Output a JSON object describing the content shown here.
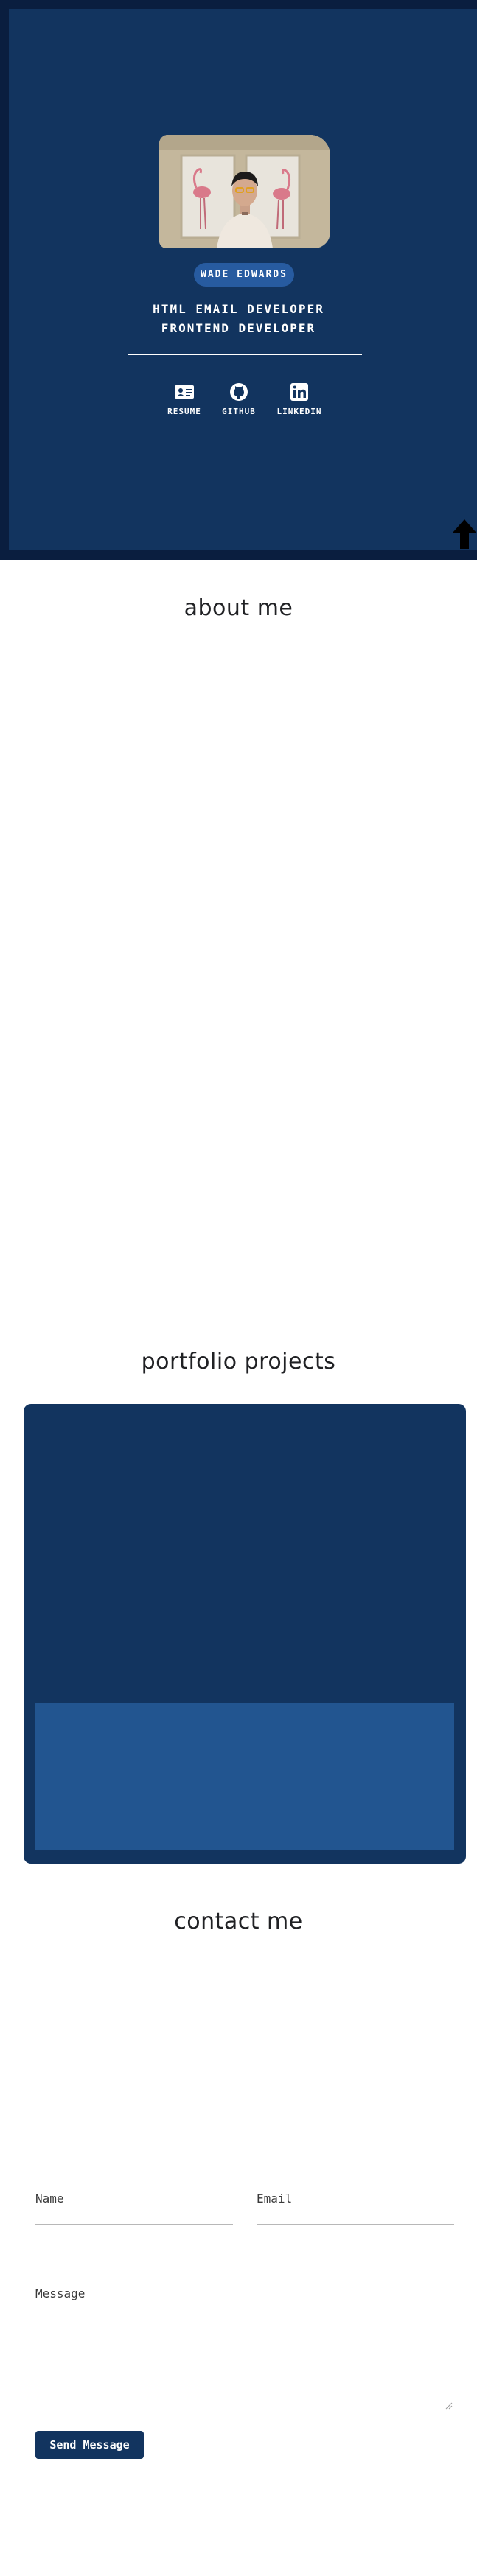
{
  "hero": {
    "name": "WADE EDWARDS",
    "title_line_1": "HTML EMAIL DEVELOPER",
    "title_line_2": "FRONTEND DEVELOPER",
    "social_links": [
      {
        "label": "RESUME",
        "icon": "id-card-icon"
      },
      {
        "label": "GITHUB",
        "icon": "github-icon"
      },
      {
        "label": "LINKEDIN",
        "icon": "linkedin-icon"
      }
    ],
    "scroll_icon": "arrow-up-icon"
  },
  "sections": {
    "about_heading": "about me",
    "portfolio_heading": "portfolio projects",
    "contact_heading": "contact me"
  },
  "contact_form": {
    "name_label": "Name",
    "email_label": "Email",
    "message_label": "Message",
    "name_value": "",
    "email_value": "",
    "message_value": "",
    "submit_label": "Send Message"
  },
  "colors": {
    "hero_border": "#0a1e3f",
    "hero_background": "#12345f",
    "badge": "#275ba0",
    "project_tile": "#225590",
    "heading_text": "#202124"
  }
}
